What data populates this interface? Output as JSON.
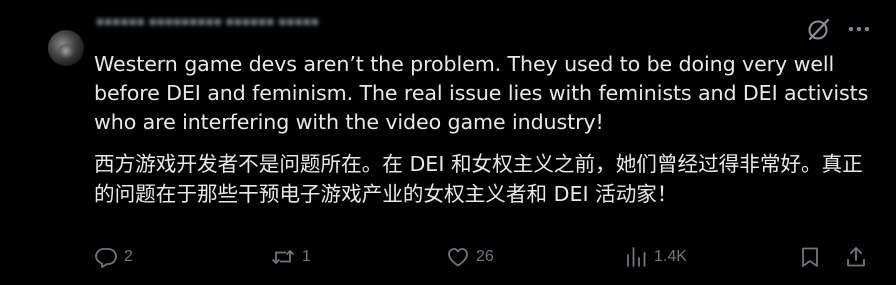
{
  "post": {
    "author_blurred": "▪▪▪▪▪▪ ▪▪▪▪▪▪▪▪▪ ▪▪▪▪▪▪ ▪▪▪▪▪",
    "text_en": "Western game devs aren’t the problem. They used to be doing very well before DEI and feminism. The real issue lies with feminists and DEI activists who are interfering with the video game industry!",
    "text_zh": "西方游戏开发者不是问题所在。在 DEI 和女权主义之前，她们曾经过得非常好。真正的问题在于那些干预电子游戏产业的女权主义者和 DEI 活动家！"
  },
  "icons": {
    "top": [
      "grok-icon",
      "more-icon"
    ],
    "actions": [
      "reply-icon",
      "repost-icon",
      "like-icon",
      "views-icon",
      "bookmark-icon",
      "share-icon"
    ]
  },
  "actions": {
    "replies": "2",
    "reposts": "1",
    "likes": "26",
    "views": "1.4K"
  },
  "colors": {
    "background": "#000000",
    "text": "#e7e9ea",
    "muted": "#71767b"
  }
}
